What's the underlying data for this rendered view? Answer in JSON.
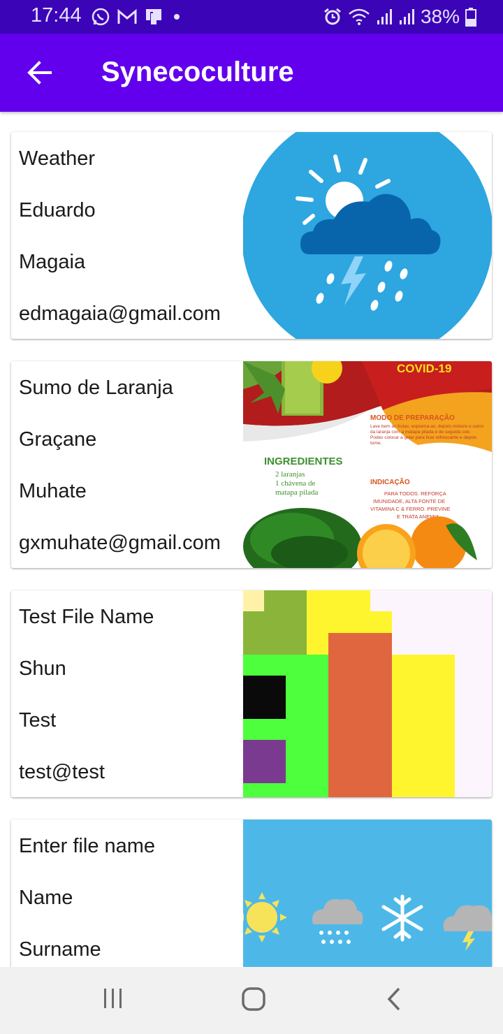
{
  "status_bar": {
    "time": "17:44",
    "battery": "38%",
    "icons": [
      "whatsapp-icon",
      "gmail-icon",
      "notification-icon",
      "dot-icon",
      "alarm-icon",
      "wifi-icon",
      "signal-icon",
      "signal-icon",
      "battery-icon"
    ]
  },
  "app_bar": {
    "title": "Synecoculture",
    "back_icon": "arrow-back-icon"
  },
  "cards": [
    {
      "line1": "Weather",
      "line2": "Eduardo",
      "line3": "Magaia",
      "line4": "edmagaia@gmail.com",
      "image": "weather-cloud-image"
    },
    {
      "line1": "Sumo de Laranja",
      "line2": "Graçane",
      "line3": "Muhate",
      "line4": "gxmuhate@gmail.com",
      "image": "orange-juice-recipe-image",
      "image_text": {
        "badge": "COVID-19",
        "ingredients_title": "INGREDIENTES",
        "ingredients": [
          "2 laranjas",
          "1 chávena de",
          "matapa pilada"
        ],
        "prep_title": "MODO DE PREPARAÇÃO",
        "prep_text": "Lave bem as frutas, esprema-as, depois misture o sumo da laranja com a matapa pilada e de seguida coe.",
        "prep_text2": "Podes colocar a gelar para ficar refrescante e depois tome.",
        "indication_title": "INDICAÇÃO",
        "indication_text": [
          "PARA TODOS. REFORÇA",
          "IMUNIDADE, ALTA FONTE DE",
          "VITAMINA C & FERRO. PREVINE",
          "E TRATA ANEMIA."
        ]
      }
    },
    {
      "line1": "Test File Name",
      "line2": "Shun",
      "line3": "Test",
      "line4": "test@test",
      "image": "color-blocks-image"
    },
    {
      "line1": "Enter file name",
      "line2": "Name",
      "line3": "Surname",
      "line4": "",
      "image": "weather-icons-image"
    }
  ],
  "nav_bar": [
    "recents-icon",
    "home-icon",
    "back-icon"
  ],
  "colors": {
    "status_bar": "#3b04b6",
    "app_bar": "#6200ee",
    "nav_bar": "#f1f1f1"
  }
}
